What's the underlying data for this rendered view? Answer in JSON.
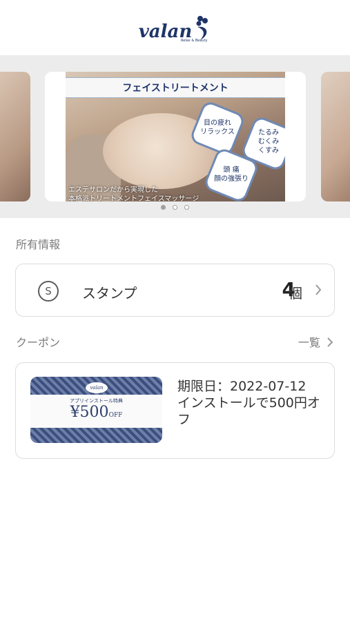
{
  "header": {
    "logo_text": "valan",
    "logo_tagline": "Relax & Beauty"
  },
  "banner": {
    "title": "フェイストリートメント",
    "badges": [
      {
        "line1": "目の疲れ",
        "line2": "リラックス"
      },
      {
        "line1": "たるみ",
        "line2": "むくみ",
        "line3": "くすみ"
      },
      {
        "line1": "頭 痛",
        "line2": "顔の強張り"
      }
    ],
    "caption_line1": "エステサロンだから実現した",
    "caption_line2": "本格派トリートメントフェイスマッサージ",
    "page_indicator": {
      "count": 3,
      "active_index": 0
    }
  },
  "holdings": {
    "section_title": "所有情報",
    "stamp": {
      "icon_letter": "S",
      "label": "スタンプ",
      "count": "4",
      "unit": "個"
    }
  },
  "coupons": {
    "section_title": "クーポン",
    "list_link": "一覧",
    "items": [
      {
        "image": {
          "brand": "valan",
          "subtitle": "アプリインストール特典",
          "price": "¥500",
          "suffix": "OFF"
        },
        "expiry": "期限日：2022-07-12",
        "description": "インストールで500円オフ"
      }
    ]
  },
  "colors": {
    "brand": "#1f3568",
    "muted": "#7b7b7b",
    "border": "#dcdcdc",
    "carousel_bg": "#ececec"
  }
}
